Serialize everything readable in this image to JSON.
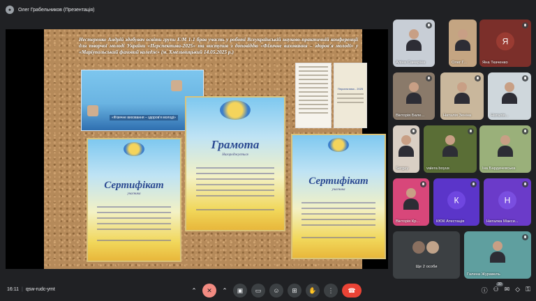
{
  "presenter": {
    "title": "Олег Грабельников (Презентація)"
  },
  "slide": {
    "text": "Нестеренко Андрій здобувач освіти групи Е/М 1-1 брав участь у роботі Всеукраїнській науково-практичній конференції для творчої молоді України «Перспектива-2025» та виступив з доповіддю «Фізичне виховання – здоров'я молоді» у «Маріупольський фаховий коледж» (м. Хмельницький 14.05.2025 р.)",
    "photo_caption": "«Фізичне виховання – здоров'я молоді»",
    "cert_left_title": "Сертифікат",
    "cert_left_sub": "учасника",
    "cert_center_title": "Грамота",
    "cert_center_sub": "Нагороджується",
    "cert_right_title": "Сертифікат",
    "cert_right_sub": "учасника",
    "poster_label": "Перспектива - 2025"
  },
  "participants": [
    {
      "name": "Аліна Самаріна",
      "muted": true,
      "bg": "#c8ced6"
    },
    {
      "name": "Олег Г...",
      "muted": false,
      "bg": "#c4a582"
    },
    {
      "name": "Яна Ткаченко",
      "muted": true,
      "initial": "Я",
      "bg": "#7b2f2a",
      "avatar": "#9a3b32"
    },
    {
      "name": "Вікторія Бале...",
      "muted": true,
      "bg": "#8a7a6a"
    },
    {
      "name": "Наталія Зеніна",
      "muted": true,
      "bg": "#c9b79c"
    },
    {
      "name": "Наталія...",
      "muted": true,
      "bg": "#cfd7dc"
    },
    {
      "name": "Sergey",
      "muted": true,
      "bg": "#d9cfc4"
    },
    {
      "name": "valera boyus",
      "muted": true,
      "bg": "#5a6e36"
    },
    {
      "name": "Іна Бардачевська",
      "muted": true,
      "bg": "#9ab07a"
    },
    {
      "name": "Вікторія Кр...",
      "muted": true,
      "bg": "#d8477a"
    },
    {
      "name": "КЮК Атестація",
      "muted": true,
      "initial": "К",
      "bg": "#5b35c9",
      "avatar": "#6f46e0"
    },
    {
      "name": "Наталка Макси...",
      "muted": true,
      "initial": "Н",
      "bg": "#6b3bc9",
      "avatar": "#7a4ee0"
    },
    {
      "name": "Ще 2 особи",
      "muted": false,
      "bg": "#3c4043"
    },
    {
      "name": "Галина Журавель",
      "muted": true,
      "bg": "#5f9f9f"
    }
  ],
  "bottom": {
    "time": "16:11",
    "meeting_code": "qsw-rudc-ymt",
    "participant_count": "30"
  },
  "icons": {
    "mic": "microphone-off-icon",
    "camera": "camera-icon",
    "emoji": "emoji-icon",
    "present": "present-icon",
    "hand": "raise-hand-icon",
    "more": "more-icon",
    "hangup": "hangup-icon",
    "info": "info-icon",
    "people": "people-icon",
    "chat": "chat-icon",
    "activities": "activities-icon",
    "lock": "host-controls-icon"
  }
}
